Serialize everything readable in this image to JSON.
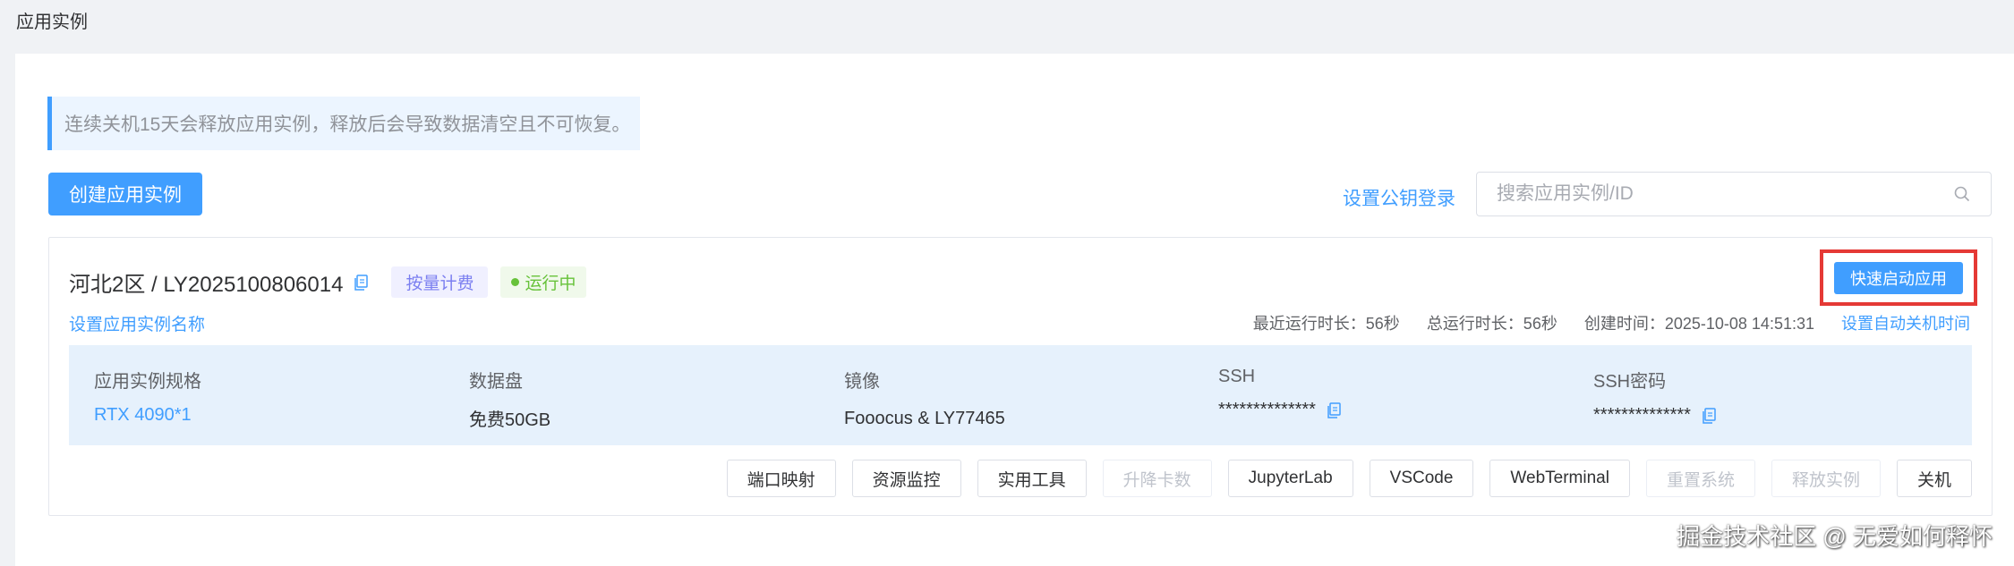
{
  "page": {
    "title": "应用实例"
  },
  "notice": {
    "text": "连续关机15天会释放应用实例，释放后会导致数据清空且不可恢复。"
  },
  "toolbar": {
    "create_label": "创建应用实例",
    "pubkey_label": "设置公钥登录",
    "search_placeholder": "搜索应用实例/ID",
    "search_value": ""
  },
  "instance": {
    "title": "河北2区 / LY2025100806014",
    "billing": "按量计费",
    "status": "运行中",
    "status_color": "#67c23a",
    "rename_label": "设置应用实例名称",
    "quick_start_label": "快速启动应用",
    "meta": {
      "recent_runtime": "最近运行时长：56秒",
      "total_runtime": "总运行时长：56秒",
      "created": "创建时间：2025-10-08 14:51:31",
      "auto_shutdown": "设置自动关机时间"
    },
    "info": [
      {
        "label": "应用实例规格",
        "value": "RTX 4090*1"
      },
      {
        "label": "数据盘",
        "value": "免费50GB"
      },
      {
        "label": "镜像",
        "value": "Fooocus & LY77465"
      },
      {
        "label": "SSH",
        "value": "**************"
      },
      {
        "label": "SSH密码",
        "value": "**************"
      }
    ],
    "actions": [
      {
        "label": "端口映射",
        "disabled": false
      },
      {
        "label": "资源监控",
        "disabled": false
      },
      {
        "label": "实用工具",
        "disabled": false
      },
      {
        "label": "升降卡数",
        "disabled": true
      },
      {
        "label": "JupyterLab",
        "disabled": false
      },
      {
        "label": "VSCode",
        "disabled": false
      },
      {
        "label": "WebTerminal",
        "disabled": false
      },
      {
        "label": "重置系统",
        "disabled": true
      },
      {
        "label": "释放实例",
        "disabled": true
      },
      {
        "label": "关机",
        "disabled": false
      }
    ]
  },
  "watermark": "掘金技术社区 @ 无爱如何释怀",
  "colors": {
    "primary": "#409eff",
    "highlight_border": "#e53935"
  }
}
